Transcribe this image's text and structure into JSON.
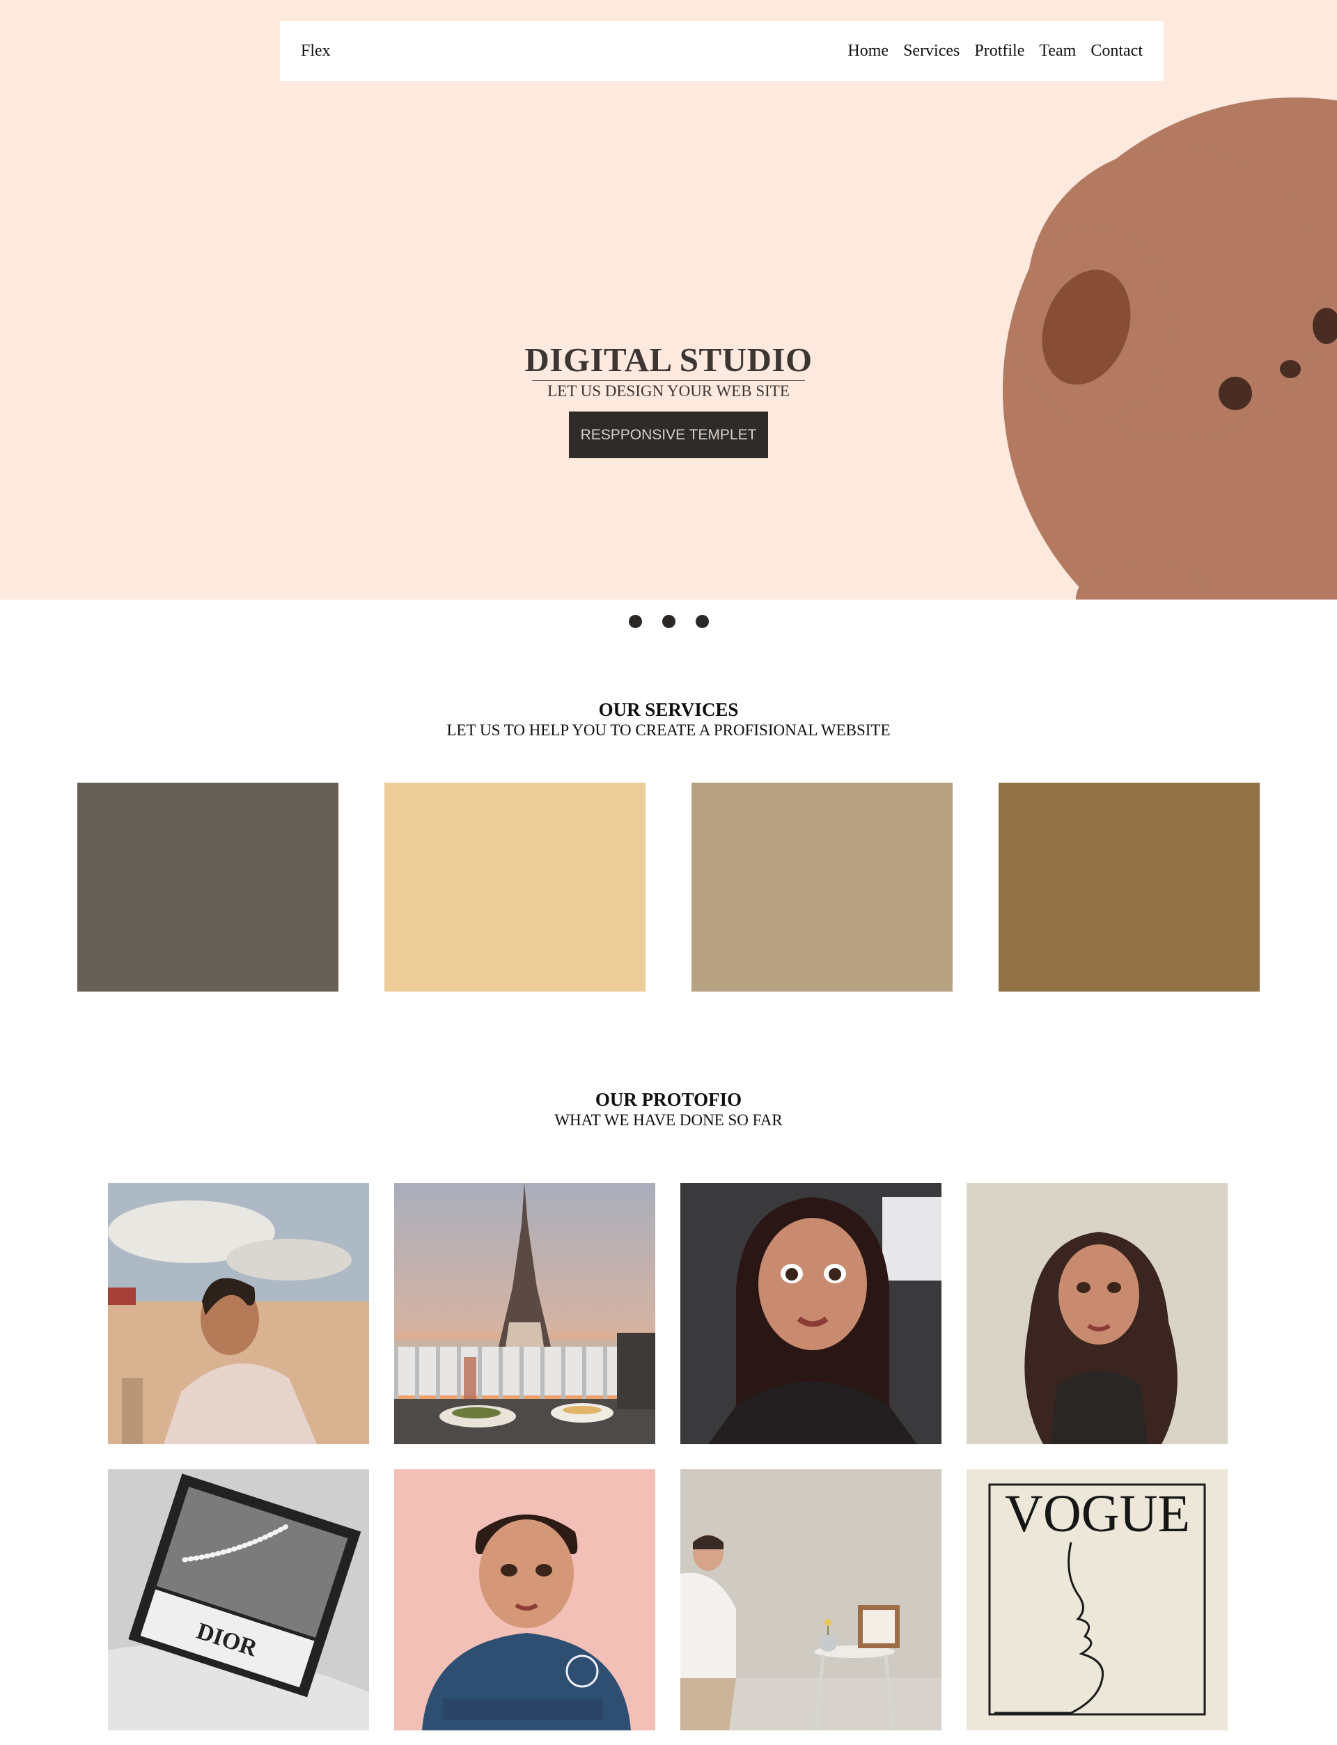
{
  "nav": {
    "brand": "Flex",
    "items": [
      "Home",
      "Services",
      "Protfile",
      "Team",
      "Contact"
    ]
  },
  "hero": {
    "title": "DIGITAL STUDIO",
    "subtitle": "LET US DESIGN YOUR WEB SITE",
    "button": "RESPPONSIVE TEMPLET"
  },
  "services": {
    "title": "OUR SERVICES",
    "subtitle": "LET US TO HELP YOU TO CREATE A PROFISIONAL WEBSITE",
    "card_colors": [
      "#676057",
      "#eccd99",
      "#b6a183",
      "#917246"
    ]
  },
  "portfolio": {
    "title": "OUR PROTOFIO",
    "subtitle": "WHAT WE HAVE DONE SO FAR",
    "tiles": [
      "beach-portrait-illustration",
      "eiffel-tower-balcony-photo",
      "car-selfie-illustration",
      "curly-hair-portrait-illustration",
      "dior-magazine-photo",
      "blue-sweater-portrait-illustration",
      "minimal-room-illustration",
      "vogue-line-art-poster"
    ],
    "vogue_text": "VOGUE",
    "dior_text": "DIOR"
  },
  "colors": {
    "hero_bg": "#fee9df",
    "bear": "#b37a61",
    "button_bg": "#2f2b28"
  }
}
